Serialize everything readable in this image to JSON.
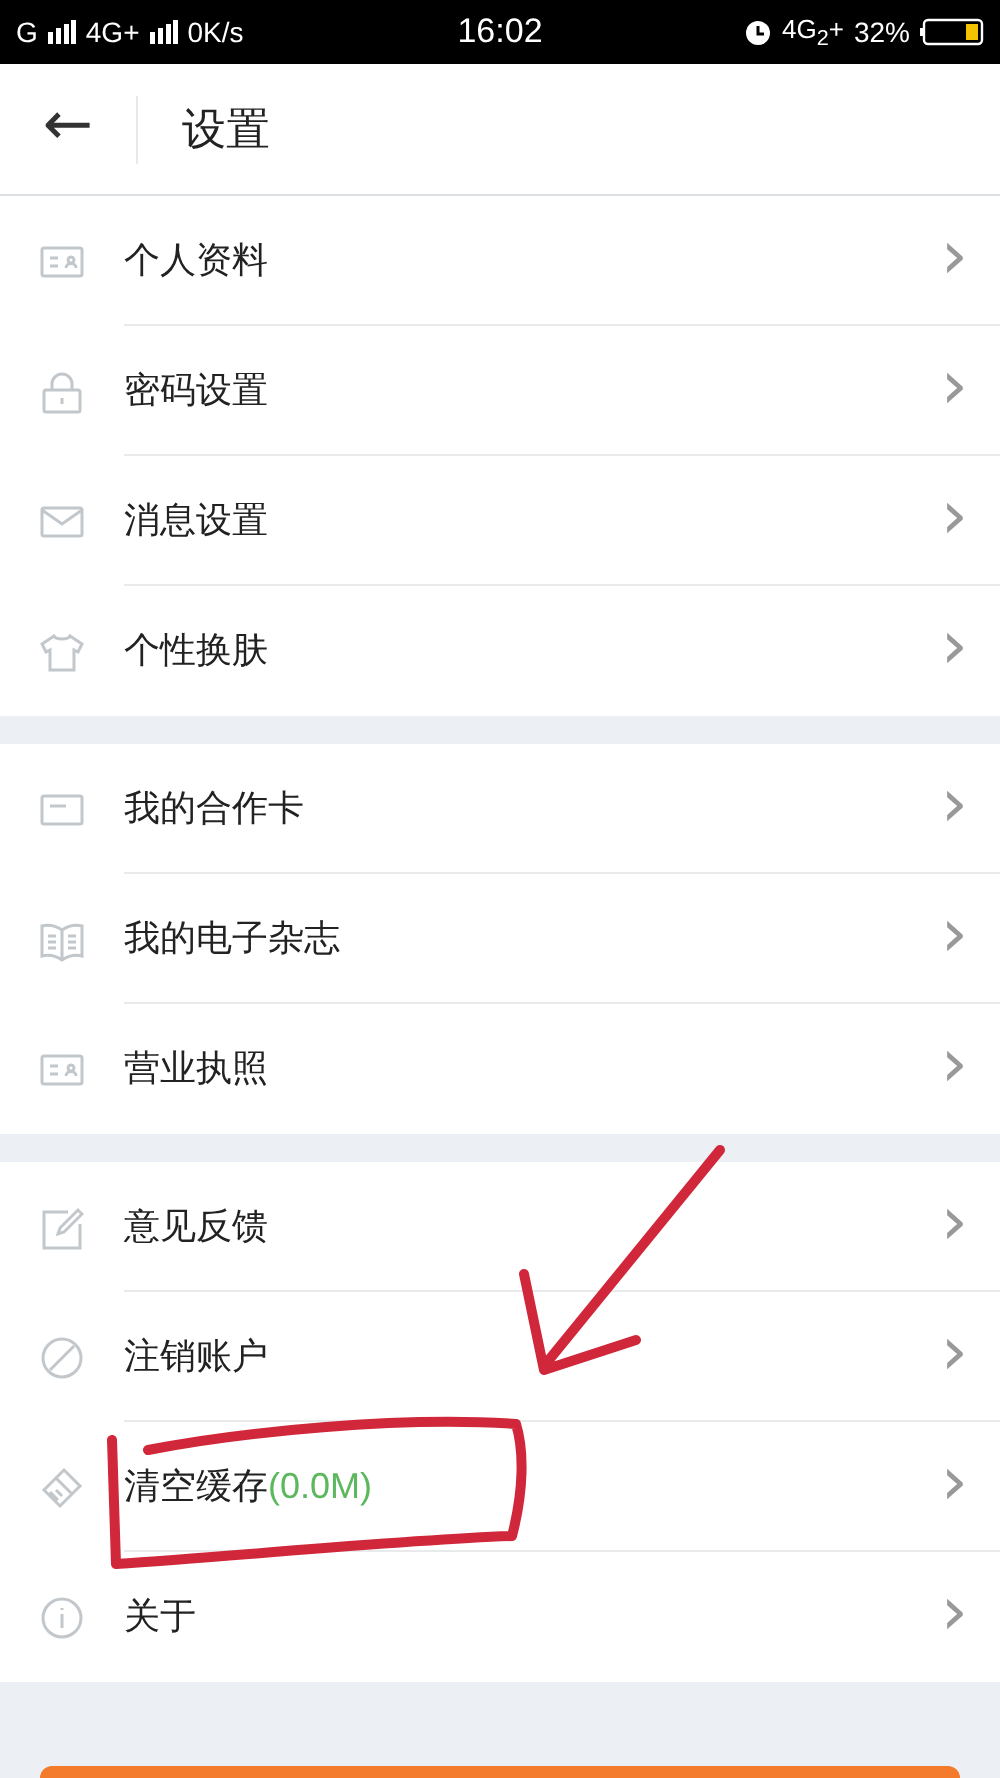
{
  "status_bar": {
    "carrier": "G",
    "network": "4G+",
    "speed": "0K/s",
    "time": "16:02",
    "network_2": "4G$_{2}$+",
    "battery": "32%"
  },
  "header": {
    "back": "←",
    "title": "设置"
  },
  "groups": [
    {
      "items": [
        {
          "kind": "idcard",
          "label": "个人资料",
          "chevron": "›"
        },
        {
          "kind": "lock",
          "label": "密码设置",
          "chevron": "›"
        },
        {
          "kind": "mail",
          "label": "消息设置",
          "chevron": "›"
        },
        {
          "kind": "shirt",
          "label": "个性换肤",
          "chevron": "›"
        }
      ]
    },
    {
      "items": [
        {
          "kind": "card",
          "label": "我的合作卡",
          "chevron": "›"
        },
        {
          "kind": "book",
          "label": "我的电子杂志",
          "chevron": "›"
        },
        {
          "kind": "idcard",
          "label": "营业执照",
          "chevron": "›"
        }
      ]
    },
    {
      "items": [
        {
          "kind": "edit",
          "label": "意见反馈",
          "chevron": "›"
        },
        {
          "kind": "ban",
          "label": "注销账户",
          "chevron": "›"
        },
        {
          "kind": "brush",
          "label": "清空缓存",
          "detail": "(0.0M)",
          "chevron": "›"
        },
        {
          "kind": "info",
          "label": "关于",
          "chevron": "›"
        }
      ]
    }
  ]
}
